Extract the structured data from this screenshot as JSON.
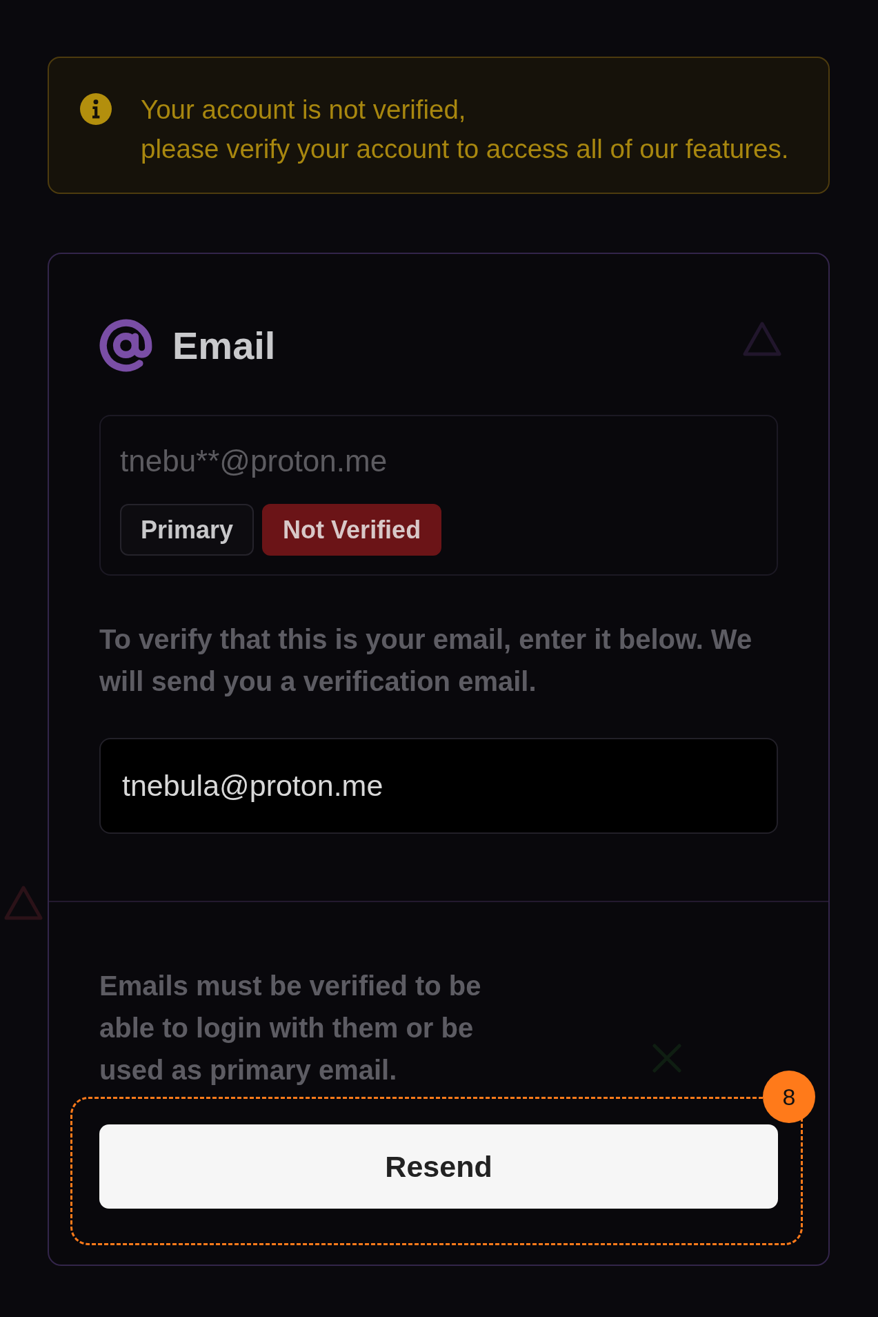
{
  "alert": {
    "kind": "info",
    "message": "Your account is not verified,\nplease verify your account to access all of our features."
  },
  "email_card": {
    "title": "Email",
    "current_email": {
      "value": "tnebu**@proton.me",
      "badges": [
        {
          "label": "Primary",
          "kind": "neutral"
        },
        {
          "label": "Not Verified",
          "kind": "danger"
        }
      ]
    },
    "instructions": "To verify that this is your email, enter it below. We will send you a verification email.",
    "email_input": {
      "value": "tnebula@proton.me"
    },
    "note": "Emails must be verified to be able to login with them or be used as primary email.",
    "button": {
      "label": "Resend"
    }
  },
  "annotation": {
    "label": "8"
  }
}
